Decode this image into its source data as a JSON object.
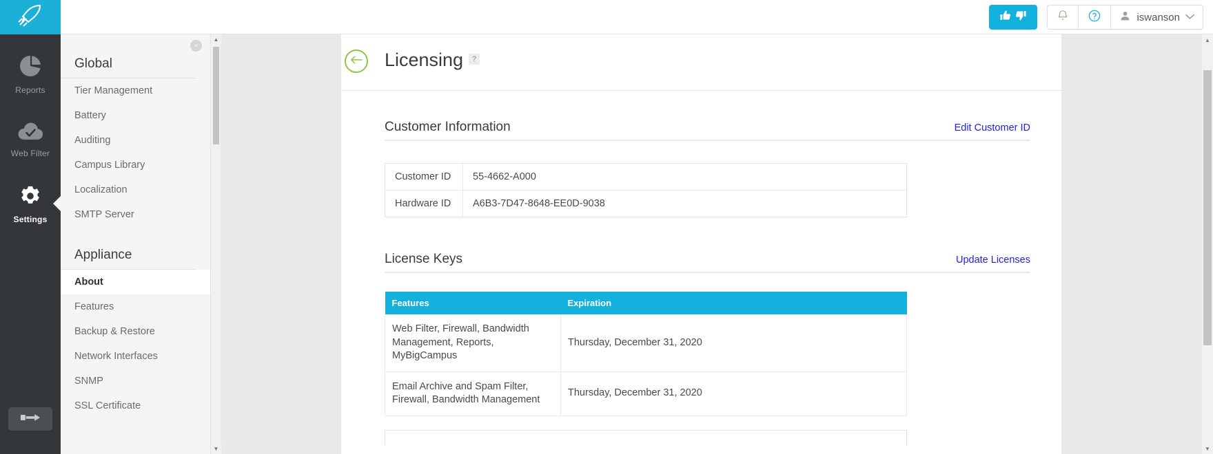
{
  "header": {
    "logo_icon": "rocket-icon",
    "rate_button": {
      "up_icon": "thumbs-up-icon",
      "down_icon": "thumbs-down-icon"
    },
    "notifications_icon": "bell-icon",
    "help_icon": "question-circle-icon",
    "user_icon": "user-avatar-icon",
    "username": "iswanson",
    "chevron": "⌄"
  },
  "rail": {
    "items": [
      {
        "label": "Reports",
        "icon": "pie-chart-icon",
        "active": false
      },
      {
        "label": "Web Filter",
        "icon": "cloud-check-icon",
        "active": false
      },
      {
        "label": "Settings",
        "icon": "gear-icon",
        "active": true
      }
    ],
    "logout_icon": "key-icon"
  },
  "subnav": {
    "close_label": "×",
    "groups": [
      {
        "title": "Global",
        "items": [
          {
            "label": "Tier Management",
            "active": false
          },
          {
            "label": "Battery",
            "active": false
          },
          {
            "label": "Auditing",
            "active": false
          },
          {
            "label": "Campus Library",
            "active": false
          },
          {
            "label": "Localization",
            "active": false
          },
          {
            "label": "SMTP Server",
            "active": false
          }
        ]
      },
      {
        "title": "Appliance",
        "items": [
          {
            "label": "About",
            "active": true
          },
          {
            "label": "Features",
            "active": false
          },
          {
            "label": "Backup & Restore",
            "active": false
          },
          {
            "label": "Network Interfaces",
            "active": false
          },
          {
            "label": "SNMP",
            "active": false
          },
          {
            "label": "SSL Certificate",
            "active": false
          }
        ]
      }
    ]
  },
  "page": {
    "back_icon": "arrow-left-icon",
    "title": "Licensing",
    "help_badge": "?",
    "customer_section": {
      "title": "Customer Information",
      "action_label": "Edit Customer ID",
      "rows": [
        {
          "key": "Customer ID",
          "value": "55-4662-A000"
        },
        {
          "key": "Hardware ID",
          "value": "A6B3-7D47-8648-EE0D-9038"
        }
      ]
    },
    "license_section": {
      "title": "License Keys",
      "action_label": "Update Licenses",
      "columns": [
        "Features",
        "Expiration"
      ],
      "rows": [
        {
          "features": "Web Filter, Firewall, Bandwidth Management, Reports, MyBigCampus",
          "expiration": "Thursday, December 31, 2020"
        },
        {
          "features": "Email Archive and Spam Filter, Firewall, Bandwidth Management",
          "expiration": "Thursday, December 31, 2020"
        }
      ]
    }
  },
  "colors": {
    "brand_cyan": "#13b1dd",
    "logo_cyan": "#1cafd8",
    "rail_dark": "#333739",
    "accent_green": "#8dc63f",
    "link_blue": "#2222dd"
  }
}
